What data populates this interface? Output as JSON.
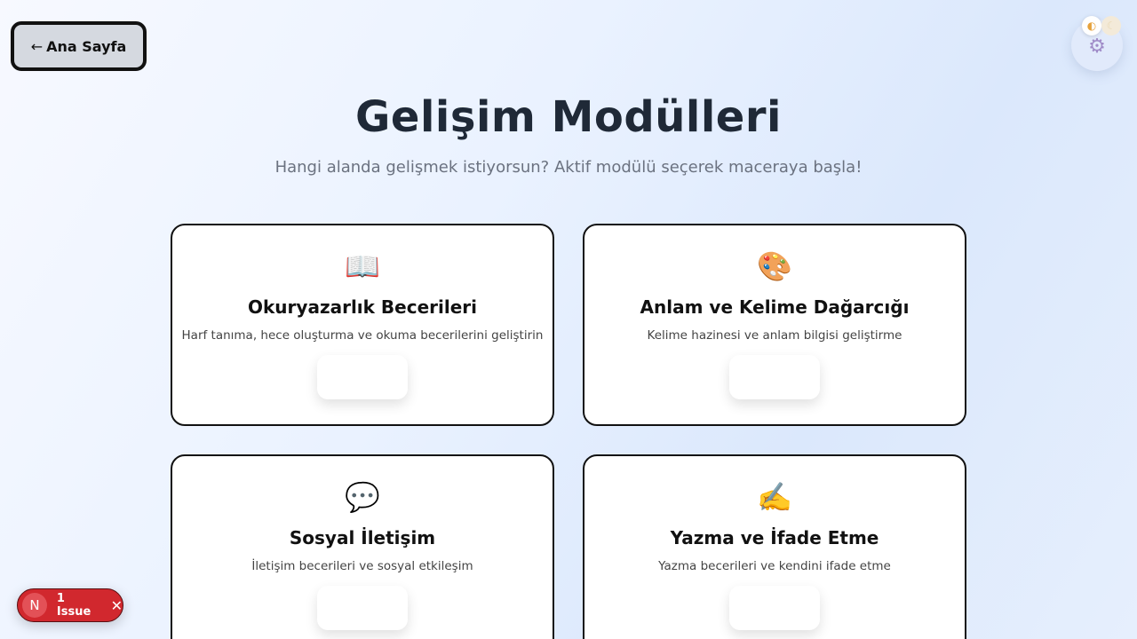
{
  "nav": {
    "back_label": "Ana Sayfa",
    "back_icon": "left-arrow-icon"
  },
  "header": {
    "title": "Gelişim Modülleri",
    "subtitle": "Hangi alanda gelişmek istiyorsun? Aktif modülü seçerek maceraya başla!"
  },
  "modules": [
    {
      "icon": "📖",
      "icon_name": "open-book-icon",
      "title": "Okuryazarlık Becerileri",
      "description": "Harf tanıma, hece oluşturma ve okuma becerilerini geliştirin"
    },
    {
      "icon": "🎨",
      "icon_name": "palette-icon",
      "title": "Anlam ve Kelime Dağarcığı",
      "description": "Kelime hazinesi ve anlam bilgisi geliştirme"
    },
    {
      "icon": "💬",
      "icon_name": "speech-bubble-icon",
      "title": "Sosyal İletişim",
      "description": "İletişim becerileri ve sosyal etkileşim"
    },
    {
      "icon": "✍️",
      "icon_name": "writing-hand-icon",
      "title": "Yazma ve İfade Etme",
      "description": "Yazma becerileri ve kendini ifade etme"
    }
  ],
  "issues": {
    "logo": "N",
    "count_label": "1 Issue"
  },
  "colors": {
    "issue_badge": "#d1282e",
    "title": "#1f2937",
    "card_border": "#111111"
  }
}
